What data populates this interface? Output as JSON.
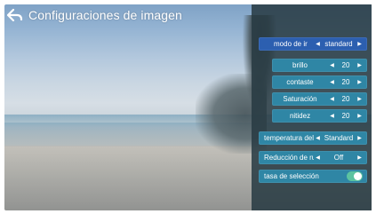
{
  "header": {
    "title": "Configuraciones de imagen",
    "back_icon": "back-arrow-icon"
  },
  "colors": {
    "panel": "#283a42",
    "row": "#2f86a5",
    "row_active": "#2c5fb0",
    "toggle_on": "#5cc3a0"
  },
  "settings": {
    "mode": {
      "label": "modo de ir",
      "value": "standard"
    },
    "brightness": {
      "label": "brillo",
      "value": "20"
    },
    "contrast": {
      "label": "contaste",
      "value": "20"
    },
    "saturation": {
      "label": "Saturación",
      "value": "20"
    },
    "sharpness": {
      "label": "nitidez",
      "value": "20"
    },
    "color_temp": {
      "label": "temperatura del",
      "value": "Standard"
    },
    "noise": {
      "label": "Reducción de ru",
      "value": "Off"
    },
    "selection_rate": {
      "label": "tasa de selección",
      "on": true
    }
  }
}
